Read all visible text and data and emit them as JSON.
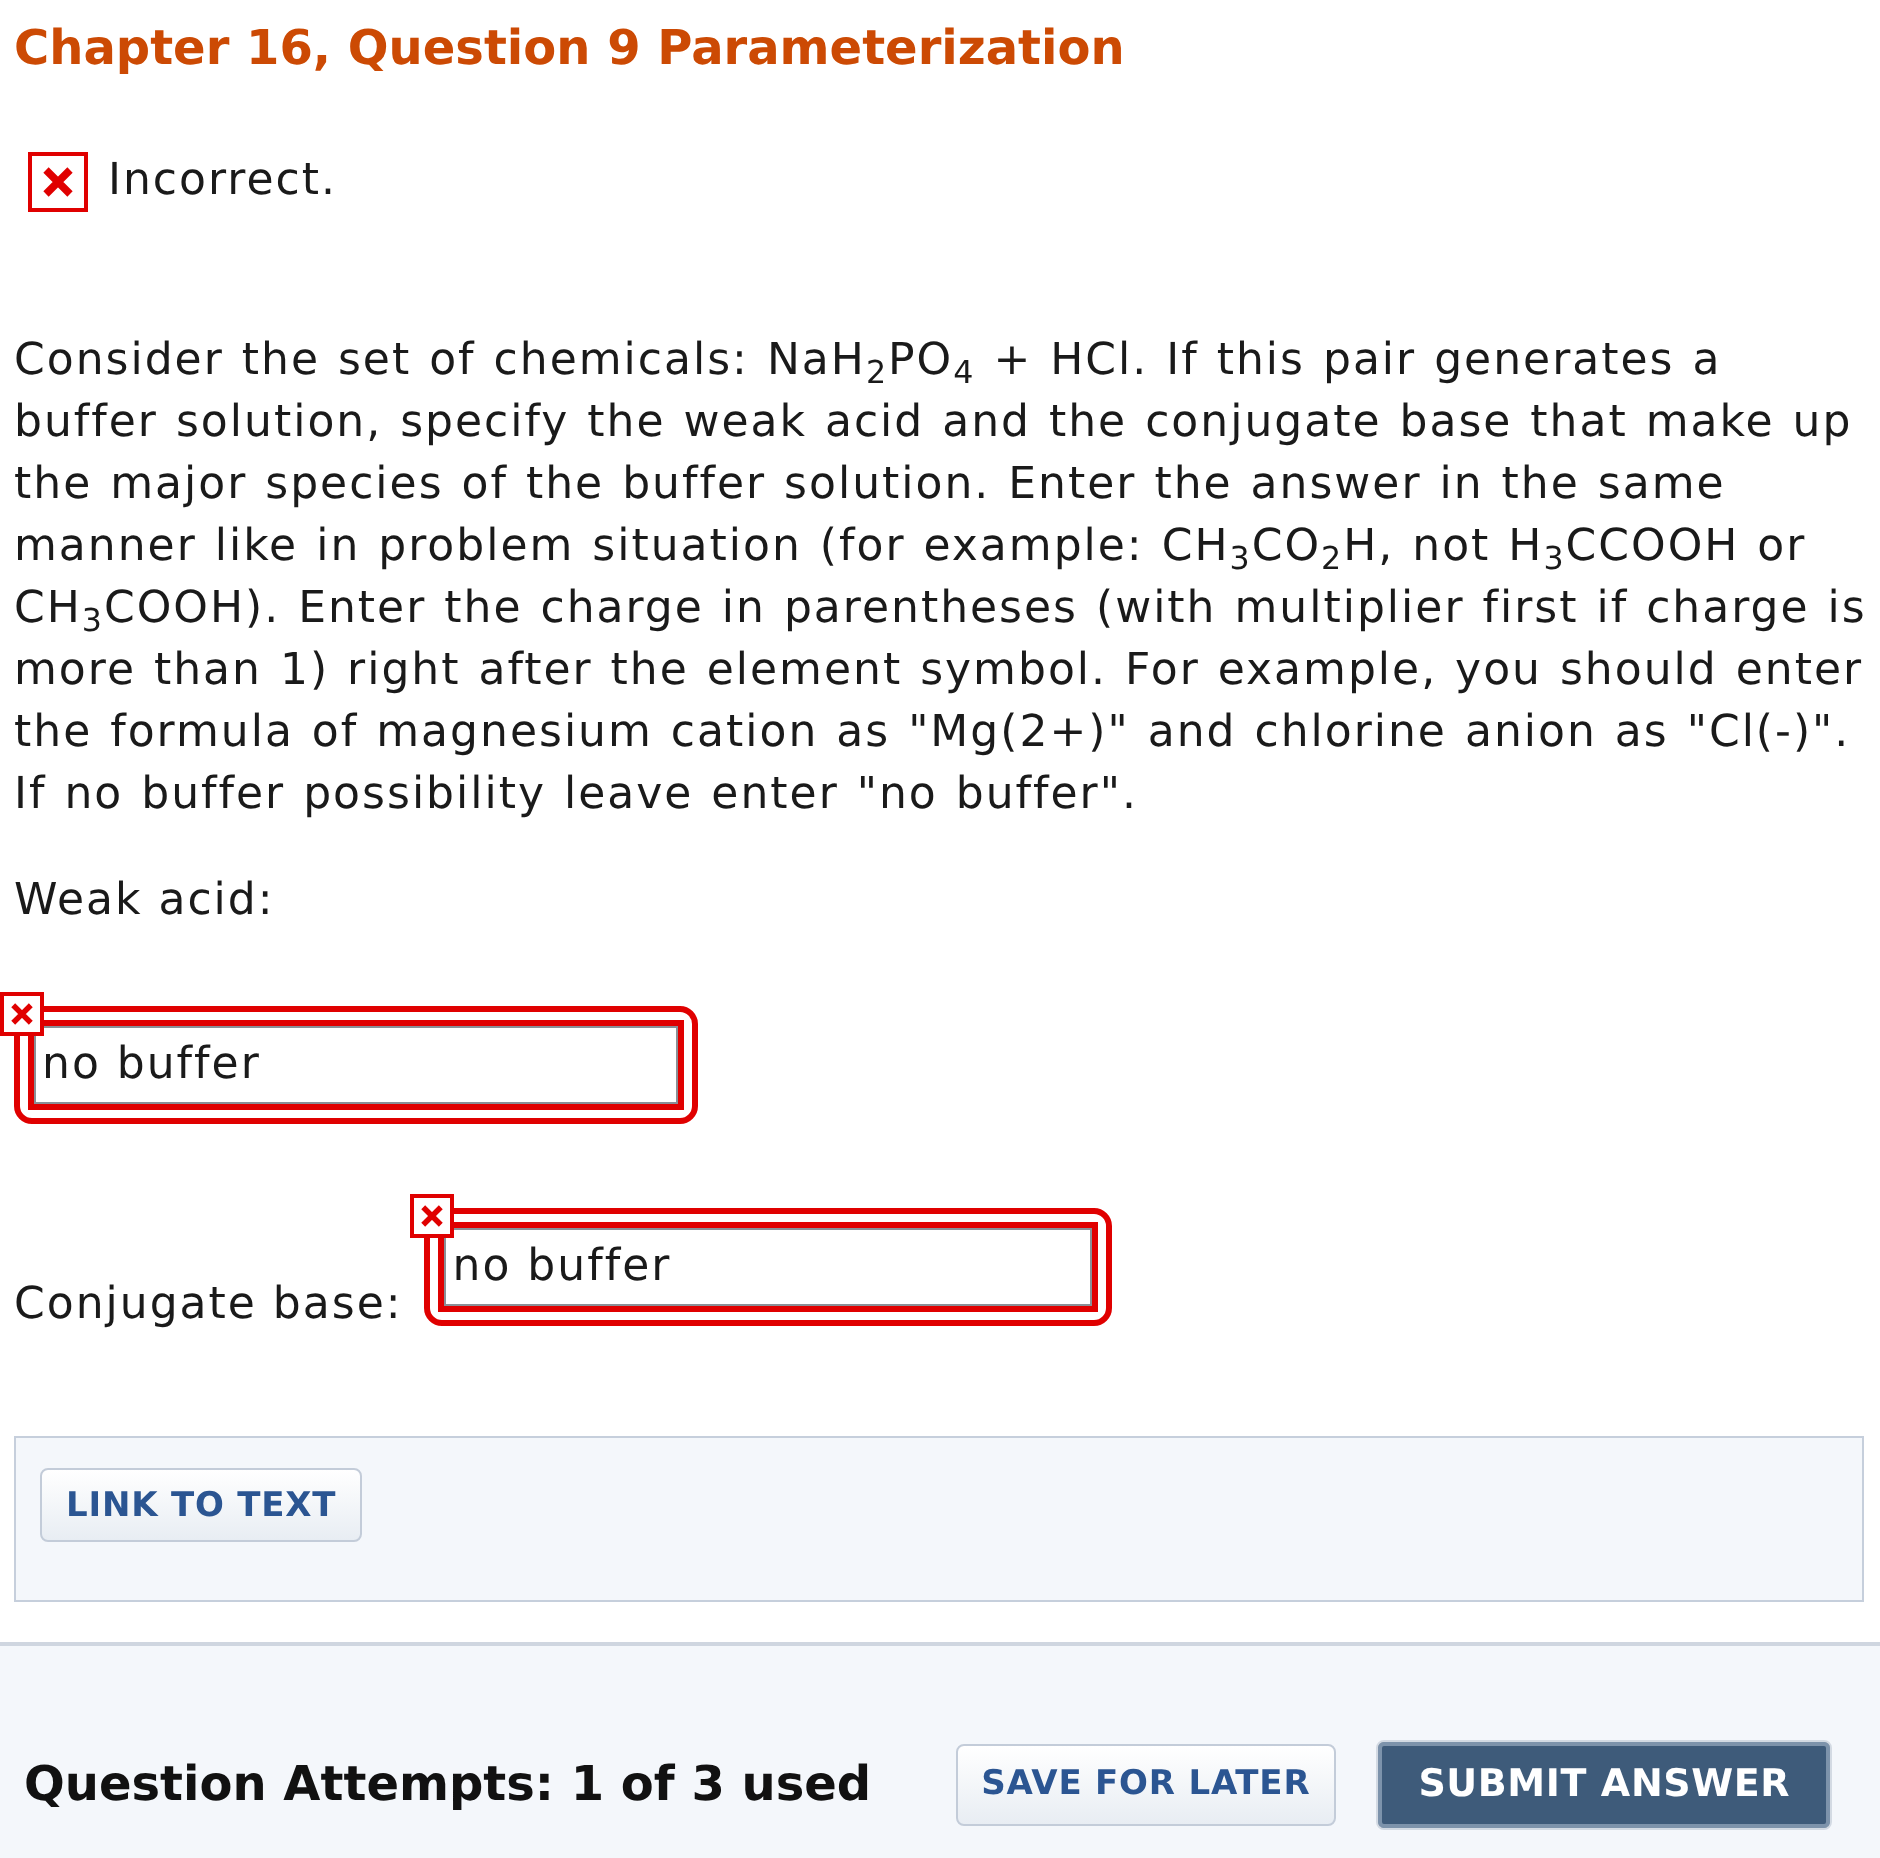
{
  "title": "Chapter 16, Question 9 Parameterization",
  "result": {
    "correct": false,
    "label": "Incorrect."
  },
  "question": {
    "text": "Consider the set of chemicals: NaH$_{2}$PO$_{4}$ + HCl. If this pair generates a buffer solution, specify the weak acid and the conjugate base that make up the major species of the buffer solution. Enter the answer in the same manner like in problem situation (for example: CH$_{3}$CO$_{2}$H, not H$_{3}$CCOOH or CH$_{3}$COOH). Enter the charge in parentheses (with multiplier first if charge is more than 1) right after the element symbol. For example, you should enter the formula of magnesium cation as \"Mg(2+)\" and chlorine anion as \"Cl(-)\". If no buffer possibility leave enter \"no buffer\"."
  },
  "answers": [
    {
      "kind": "stacked",
      "label": "Weak acid:",
      "value": "no buffer",
      "correct": false
    },
    {
      "kind": "inline",
      "label": "Conjugate base:",
      "value": "no buffer",
      "correct": false
    }
  ],
  "resources": {
    "buttons": [
      "LINK TO TEXT"
    ]
  },
  "footer": {
    "attempts": "Question Attempts: 1 of 3 used",
    "buttons": [
      {
        "kind": "secondary",
        "label": "SAVE FOR LATER"
      },
      {
        "kind": "primary",
        "label": "SUBMIT ANSWER"
      }
    ]
  }
}
